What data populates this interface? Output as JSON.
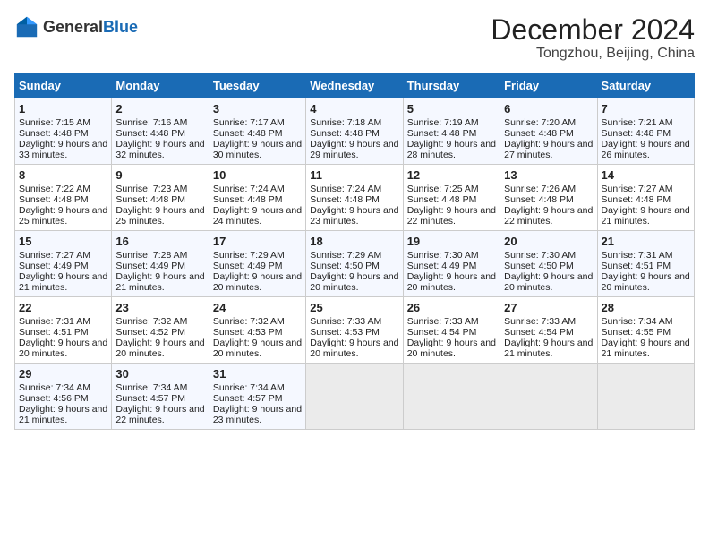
{
  "header": {
    "logo_general": "General",
    "logo_blue": "Blue",
    "month_title": "December 2024",
    "location": "Tongzhou, Beijing, China"
  },
  "days_of_week": [
    "Sunday",
    "Monday",
    "Tuesday",
    "Wednesday",
    "Thursday",
    "Friday",
    "Saturday"
  ],
  "weeks": [
    [
      {
        "day": 1,
        "sunrise": "Sunrise: 7:15 AM",
        "sunset": "Sunset: 4:48 PM",
        "daylight": "Daylight: 9 hours and 33 minutes."
      },
      {
        "day": 2,
        "sunrise": "Sunrise: 7:16 AM",
        "sunset": "Sunset: 4:48 PM",
        "daylight": "Daylight: 9 hours and 32 minutes."
      },
      {
        "day": 3,
        "sunrise": "Sunrise: 7:17 AM",
        "sunset": "Sunset: 4:48 PM",
        "daylight": "Daylight: 9 hours and 30 minutes."
      },
      {
        "day": 4,
        "sunrise": "Sunrise: 7:18 AM",
        "sunset": "Sunset: 4:48 PM",
        "daylight": "Daylight: 9 hours and 29 minutes."
      },
      {
        "day": 5,
        "sunrise": "Sunrise: 7:19 AM",
        "sunset": "Sunset: 4:48 PM",
        "daylight": "Daylight: 9 hours and 28 minutes."
      },
      {
        "day": 6,
        "sunrise": "Sunrise: 7:20 AM",
        "sunset": "Sunset: 4:48 PM",
        "daylight": "Daylight: 9 hours and 27 minutes."
      },
      {
        "day": 7,
        "sunrise": "Sunrise: 7:21 AM",
        "sunset": "Sunset: 4:48 PM",
        "daylight": "Daylight: 9 hours and 26 minutes."
      }
    ],
    [
      {
        "day": 8,
        "sunrise": "Sunrise: 7:22 AM",
        "sunset": "Sunset: 4:48 PM",
        "daylight": "Daylight: 9 hours and 25 minutes."
      },
      {
        "day": 9,
        "sunrise": "Sunrise: 7:23 AM",
        "sunset": "Sunset: 4:48 PM",
        "daylight": "Daylight: 9 hours and 25 minutes."
      },
      {
        "day": 10,
        "sunrise": "Sunrise: 7:24 AM",
        "sunset": "Sunset: 4:48 PM",
        "daylight": "Daylight: 9 hours and 24 minutes."
      },
      {
        "day": 11,
        "sunrise": "Sunrise: 7:24 AM",
        "sunset": "Sunset: 4:48 PM",
        "daylight": "Daylight: 9 hours and 23 minutes."
      },
      {
        "day": 12,
        "sunrise": "Sunrise: 7:25 AM",
        "sunset": "Sunset: 4:48 PM",
        "daylight": "Daylight: 9 hours and 22 minutes."
      },
      {
        "day": 13,
        "sunrise": "Sunrise: 7:26 AM",
        "sunset": "Sunset: 4:48 PM",
        "daylight": "Daylight: 9 hours and 22 minutes."
      },
      {
        "day": 14,
        "sunrise": "Sunrise: 7:27 AM",
        "sunset": "Sunset: 4:48 PM",
        "daylight": "Daylight: 9 hours and 21 minutes."
      }
    ],
    [
      {
        "day": 15,
        "sunrise": "Sunrise: 7:27 AM",
        "sunset": "Sunset: 4:49 PM",
        "daylight": "Daylight: 9 hours and 21 minutes."
      },
      {
        "day": 16,
        "sunrise": "Sunrise: 7:28 AM",
        "sunset": "Sunset: 4:49 PM",
        "daylight": "Daylight: 9 hours and 21 minutes."
      },
      {
        "day": 17,
        "sunrise": "Sunrise: 7:29 AM",
        "sunset": "Sunset: 4:49 PM",
        "daylight": "Daylight: 9 hours and 20 minutes."
      },
      {
        "day": 18,
        "sunrise": "Sunrise: 7:29 AM",
        "sunset": "Sunset: 4:50 PM",
        "daylight": "Daylight: 9 hours and 20 minutes."
      },
      {
        "day": 19,
        "sunrise": "Sunrise: 7:30 AM",
        "sunset": "Sunset: 4:49 PM",
        "daylight": "Daylight: 9 hours and 20 minutes."
      },
      {
        "day": 20,
        "sunrise": "Sunrise: 7:30 AM",
        "sunset": "Sunset: 4:50 PM",
        "daylight": "Daylight: 9 hours and 20 minutes."
      },
      {
        "day": 21,
        "sunrise": "Sunrise: 7:31 AM",
        "sunset": "Sunset: 4:51 PM",
        "daylight": "Daylight: 9 hours and 20 minutes."
      }
    ],
    [
      {
        "day": 22,
        "sunrise": "Sunrise: 7:31 AM",
        "sunset": "Sunset: 4:51 PM",
        "daylight": "Daylight: 9 hours and 20 minutes."
      },
      {
        "day": 23,
        "sunrise": "Sunrise: 7:32 AM",
        "sunset": "Sunset: 4:52 PM",
        "daylight": "Daylight: 9 hours and 20 minutes."
      },
      {
        "day": 24,
        "sunrise": "Sunrise: 7:32 AM",
        "sunset": "Sunset: 4:53 PM",
        "daylight": "Daylight: 9 hours and 20 minutes."
      },
      {
        "day": 25,
        "sunrise": "Sunrise: 7:33 AM",
        "sunset": "Sunset: 4:53 PM",
        "daylight": "Daylight: 9 hours and 20 minutes."
      },
      {
        "day": 26,
        "sunrise": "Sunrise: 7:33 AM",
        "sunset": "Sunset: 4:54 PM",
        "daylight": "Daylight: 9 hours and 20 minutes."
      },
      {
        "day": 27,
        "sunrise": "Sunrise: 7:33 AM",
        "sunset": "Sunset: 4:54 PM",
        "daylight": "Daylight: 9 hours and 21 minutes."
      },
      {
        "day": 28,
        "sunrise": "Sunrise: 7:34 AM",
        "sunset": "Sunset: 4:55 PM",
        "daylight": "Daylight: 9 hours and 21 minutes."
      }
    ],
    [
      {
        "day": 29,
        "sunrise": "Sunrise: 7:34 AM",
        "sunset": "Sunset: 4:56 PM",
        "daylight": "Daylight: 9 hours and 21 minutes."
      },
      {
        "day": 30,
        "sunrise": "Sunrise: 7:34 AM",
        "sunset": "Sunset: 4:57 PM",
        "daylight": "Daylight: 9 hours and 22 minutes."
      },
      {
        "day": 31,
        "sunrise": "Sunrise: 7:34 AM",
        "sunset": "Sunset: 4:57 PM",
        "daylight": "Daylight: 9 hours and 23 minutes."
      },
      null,
      null,
      null,
      null
    ]
  ]
}
